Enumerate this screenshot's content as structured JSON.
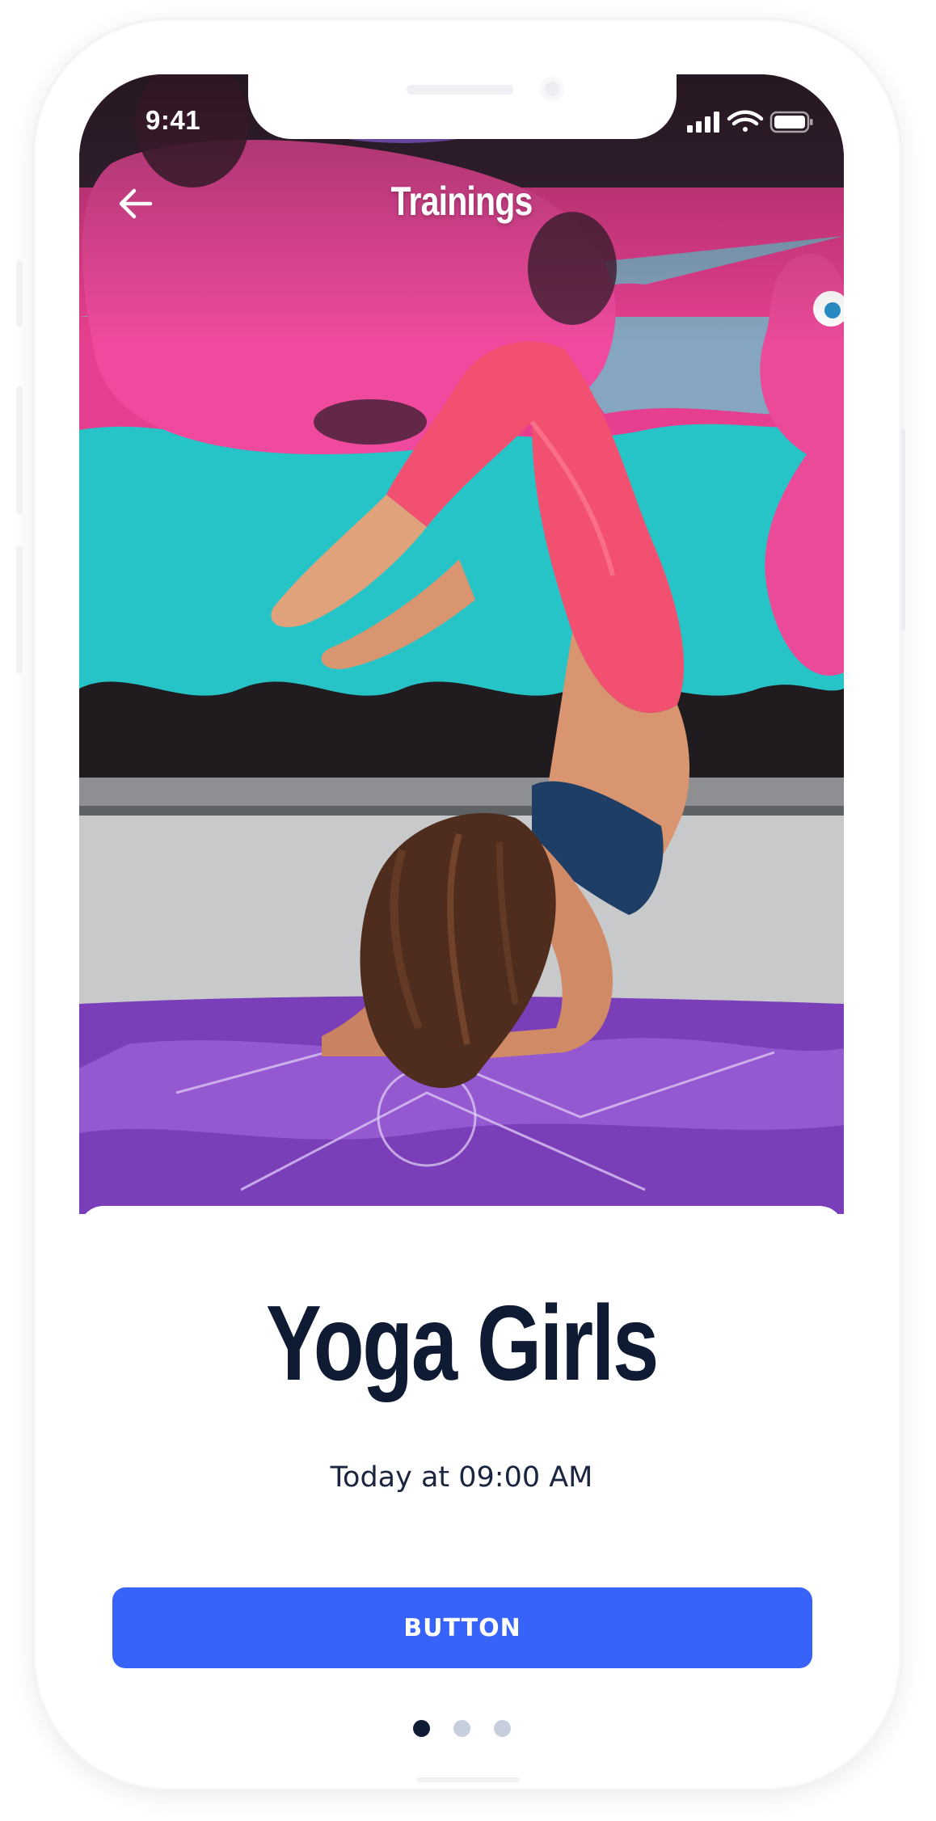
{
  "status_bar": {
    "time": "9:41",
    "icons": [
      "cellular-signal-icon",
      "wifi-icon",
      "battery-icon"
    ]
  },
  "nav": {
    "back_icon": "arrow-left-icon",
    "title": "Trainings"
  },
  "hero": {
    "image": "photo of a woman in a forearm-stand yoga pose in front of a colorful graffiti wall"
  },
  "card": {
    "title": "Yoga Girls",
    "subtitle": "Today at 09:00 AM",
    "button_label": "BUTTON"
  },
  "pager": {
    "count": 3,
    "active_index": 0
  },
  "colors": {
    "accent": "#3763f8",
    "title_text": "#0f1a33",
    "dot_active": "#0f1a33",
    "dot_inactive": "#c8cfdc"
  }
}
